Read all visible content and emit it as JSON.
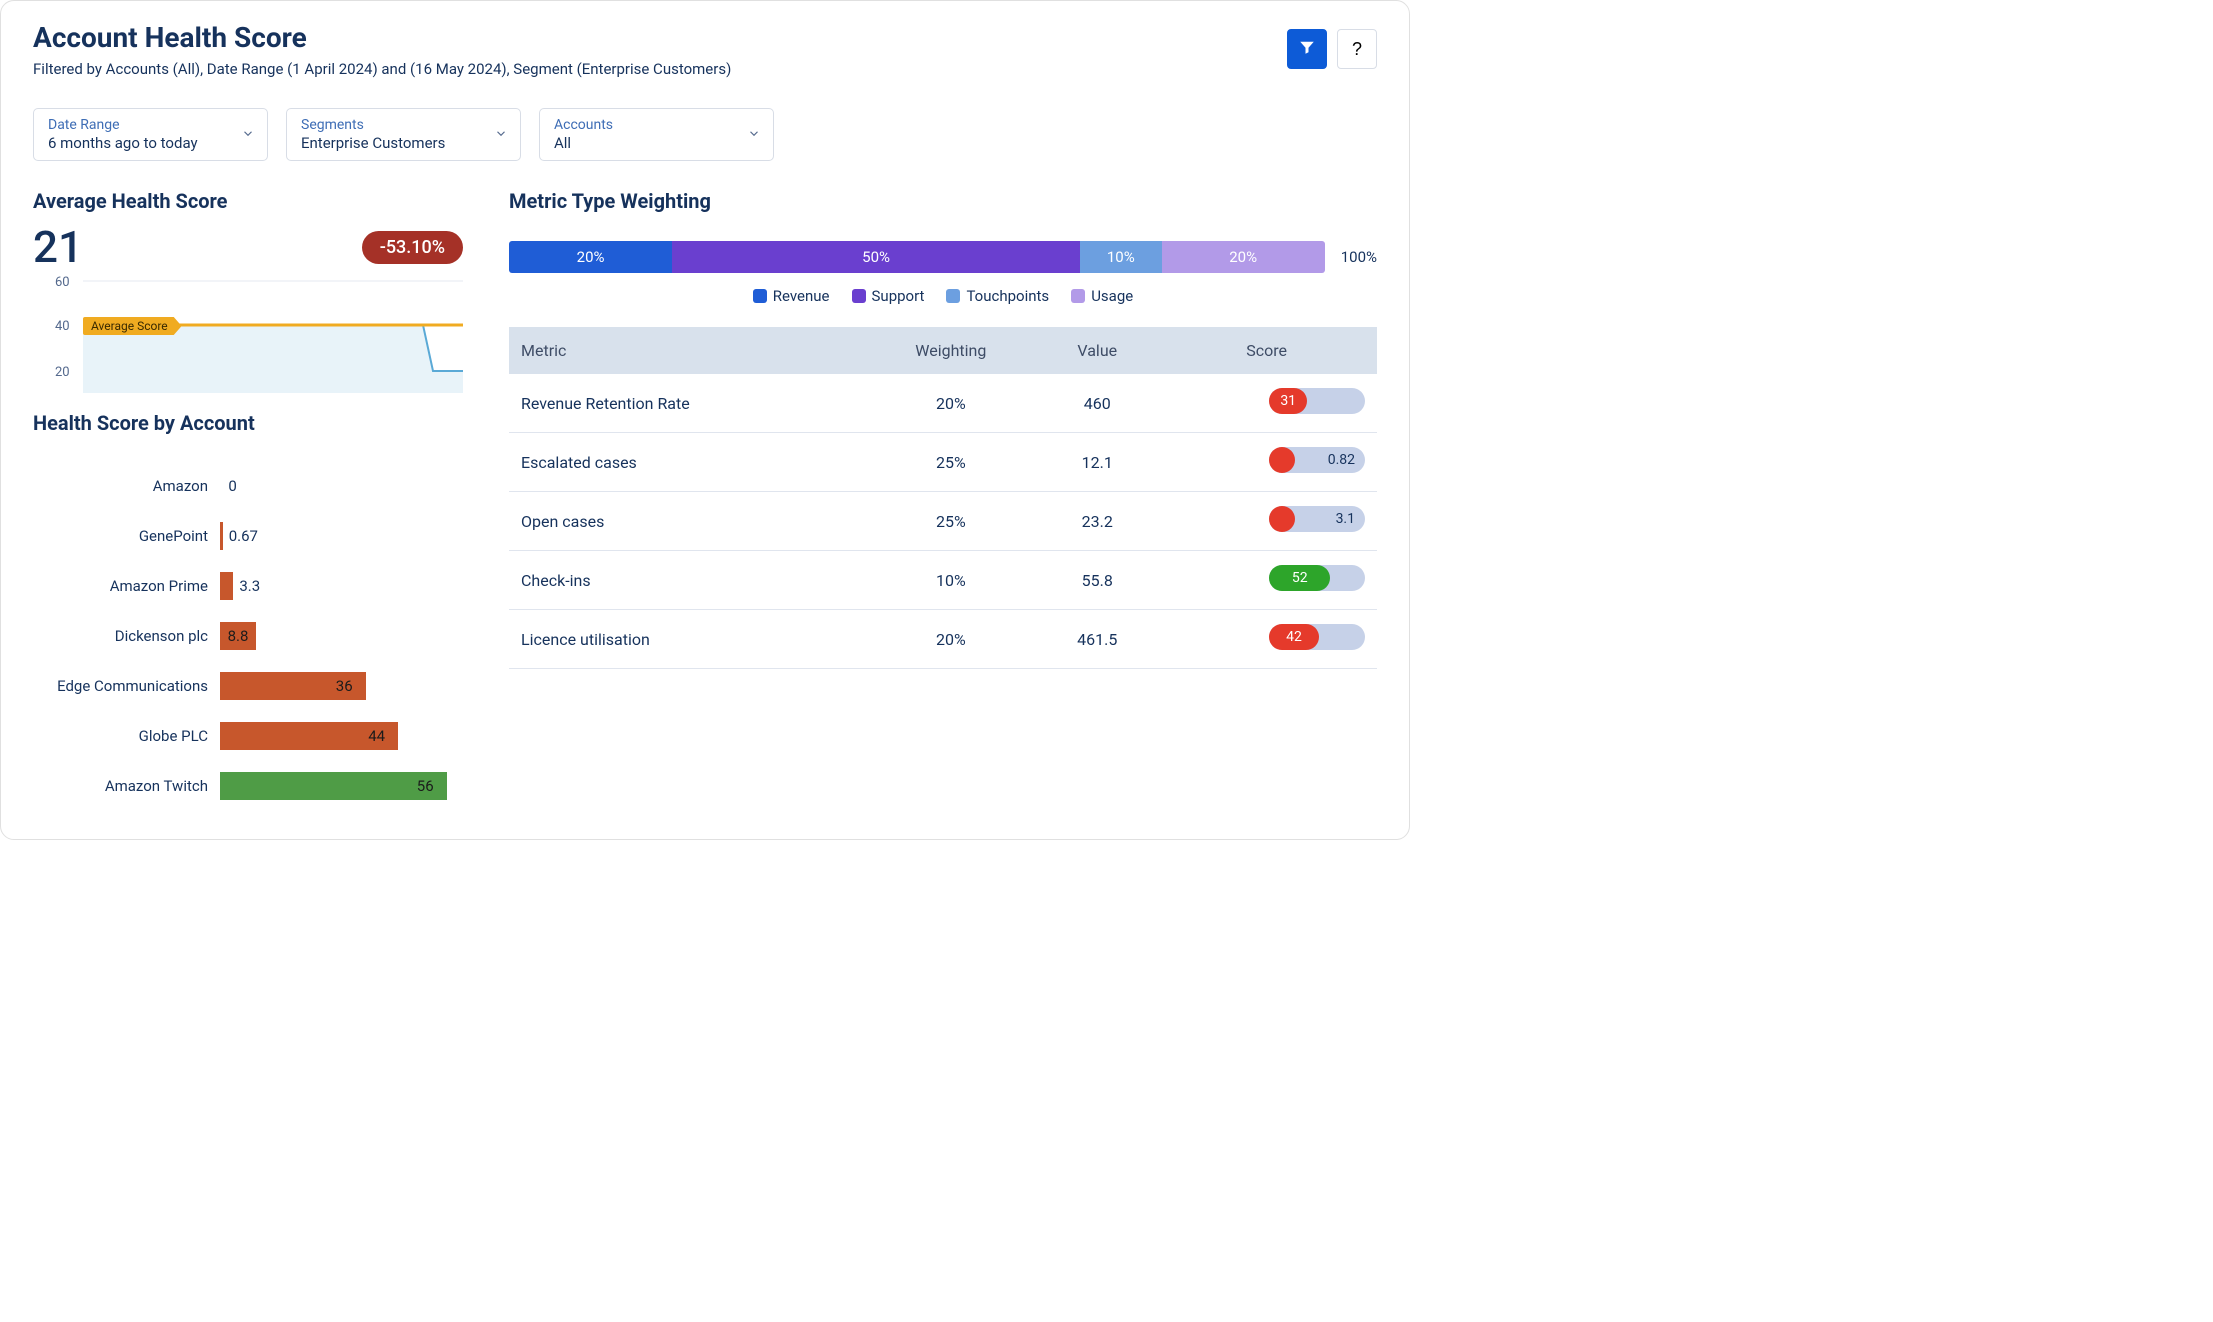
{
  "header": {
    "title": "Account Health Score",
    "filter_summary": "Filtered by Accounts (All), Date Range (1 April 2024) and (16 May 2024), Segment (Enterprise Customers)",
    "help_label": "?"
  },
  "filters": {
    "date_range": {
      "label": "Date Range",
      "value": "6 months ago to today"
    },
    "segments": {
      "label": "Segments",
      "value": "Enterprise Customers"
    },
    "accounts": {
      "label": "Accounts",
      "value": "All"
    }
  },
  "avg_health": {
    "title": "Average Health Score",
    "score": "21",
    "delta": "-53.10%",
    "overlay_label": "Average Score"
  },
  "by_account": {
    "title": "Health Score by Account"
  },
  "weighting": {
    "title": "Metric Type Weighting",
    "total": "100%",
    "segments": [
      {
        "label": "20%",
        "color": "#1f5dd6"
      },
      {
        "label": "50%",
        "color": "#6a3fcf"
      },
      {
        "label": "10%",
        "color": "#6c9fe0"
      },
      {
        "label": "20%",
        "color": "#b29ae8"
      }
    ],
    "legend": [
      {
        "label": "Revenue",
        "color": "#1f5dd6"
      },
      {
        "label": "Support",
        "color": "#6a3fcf"
      },
      {
        "label": "Touchpoints",
        "color": "#6c9fe0"
      },
      {
        "label": "Usage",
        "color": "#b29ae8"
      }
    ]
  },
  "metric_table": {
    "columns": {
      "metric": "Metric",
      "weighting": "Weighting",
      "value": "Value",
      "score": "Score"
    },
    "rows": [
      {
        "metric": "Revenue Retention Rate",
        "weighting": "20%",
        "value": "460",
        "score": "31",
        "style": "fill-red",
        "pct": 40
      },
      {
        "metric": "Escalated cases",
        "weighting": "25%",
        "value": "12.1",
        "score": "0.82",
        "style": "dot-red",
        "pct": 0
      },
      {
        "metric": "Open cases",
        "weighting": "25%",
        "value": "23.2",
        "score": "3.1",
        "style": "dot-red",
        "pct": 0
      },
      {
        "metric": "Check-ins",
        "weighting": "10%",
        "value": "55.8",
        "score": "52",
        "style": "fill-green",
        "pct": 64
      },
      {
        "metric": "Licence utilisation",
        "weighting": "20%",
        "value": "461.5",
        "score": "42",
        "style": "fill-red",
        "pct": 52
      }
    ]
  },
  "chart_data": [
    {
      "type": "line",
      "name": "Average Health Score trend",
      "ylim": [
        10,
        60
      ],
      "yticks": [
        20,
        40,
        60
      ],
      "reference_line": {
        "label": "Average Score",
        "value": 40
      },
      "series": [
        {
          "name": "Health Score",
          "values": [
            40,
            40,
            40,
            40,
            40,
            40,
            40,
            40,
            40,
            40,
            40,
            21
          ]
        }
      ]
    },
    {
      "type": "bar",
      "name": "Health Score by Account",
      "orientation": "horizontal",
      "xlim": [
        0,
        60
      ],
      "categories": [
        "Amazon",
        "GenePoint",
        "Amazon Prime",
        "Dickenson plc",
        "Edge Communications",
        "Globe PLC",
        "Amazon Twitch"
      ],
      "values": [
        0,
        0.67,
        3.3,
        8.8,
        36,
        44,
        56
      ],
      "color_rule": "value>=50 ? green : orange"
    },
    {
      "type": "bar",
      "name": "Metric Type Weighting (stacked 100%)",
      "orientation": "horizontal",
      "categories": [
        "Revenue",
        "Support",
        "Touchpoints",
        "Usage"
      ],
      "values": [
        20,
        50,
        10,
        20
      ],
      "total": 100
    }
  ]
}
